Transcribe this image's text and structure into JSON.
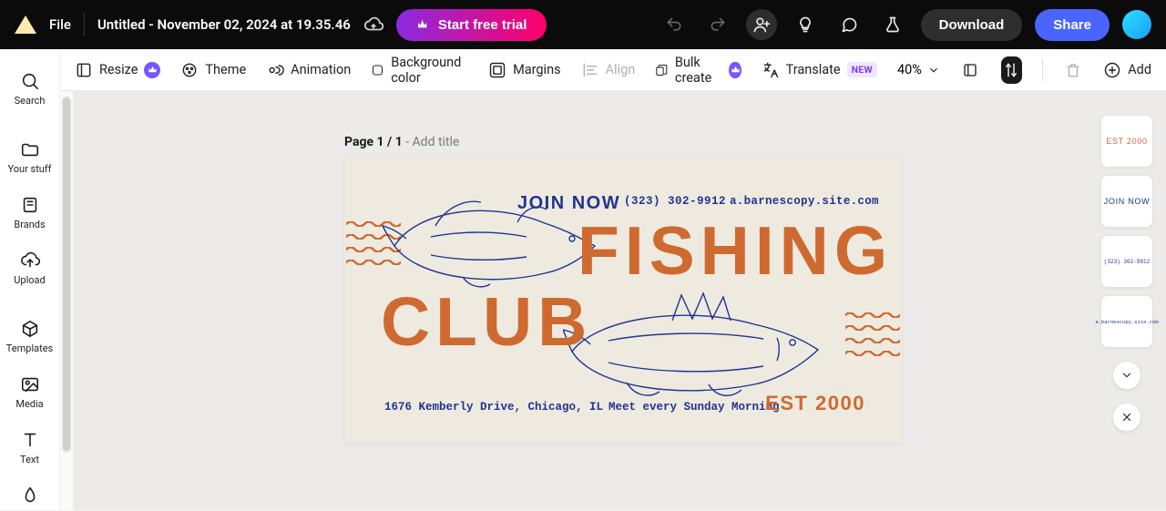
{
  "header": {
    "file_label": "File",
    "doc_title": "Untitled - November 02, 2024 at 19.35.46",
    "trial_label": "Start free trial",
    "download_label": "Download",
    "share_label": "Share"
  },
  "toolbar": {
    "resize": "Resize",
    "theme": "Theme",
    "animation": "Animation",
    "background": "Background color",
    "margins": "Margins",
    "align": "Align",
    "bulk": "Bulk create",
    "translate": "Translate",
    "new_badge": "NEW",
    "zoom": "40%",
    "add": "Add"
  },
  "rail": {
    "search": "Search",
    "your_stuff": "Your stuff",
    "brands": "Brands",
    "upload": "Upload",
    "templates": "Templates",
    "media": "Media",
    "text": "Text"
  },
  "page_label": {
    "page_word": "Page ",
    "current": "1",
    "sep": " / ",
    "total": "1",
    "add_title": " - Add title"
  },
  "design": {
    "join_now": "JOIN NOW",
    "phone": "(323) 302-9912",
    "website": "a.barnescopy.site.com",
    "word1": "FISHING",
    "word2": "CLUB",
    "est": "EST 2000",
    "address": "1676 Kemberly Drive, Chicago, IL",
    "meeting": "Meet every Sunday Morning"
  },
  "thumbs": {
    "t1": "EST 2000",
    "t2": "JOIN NOW",
    "t3": "(323) 302-9912",
    "t4": "a.barnescopy.site.com"
  }
}
